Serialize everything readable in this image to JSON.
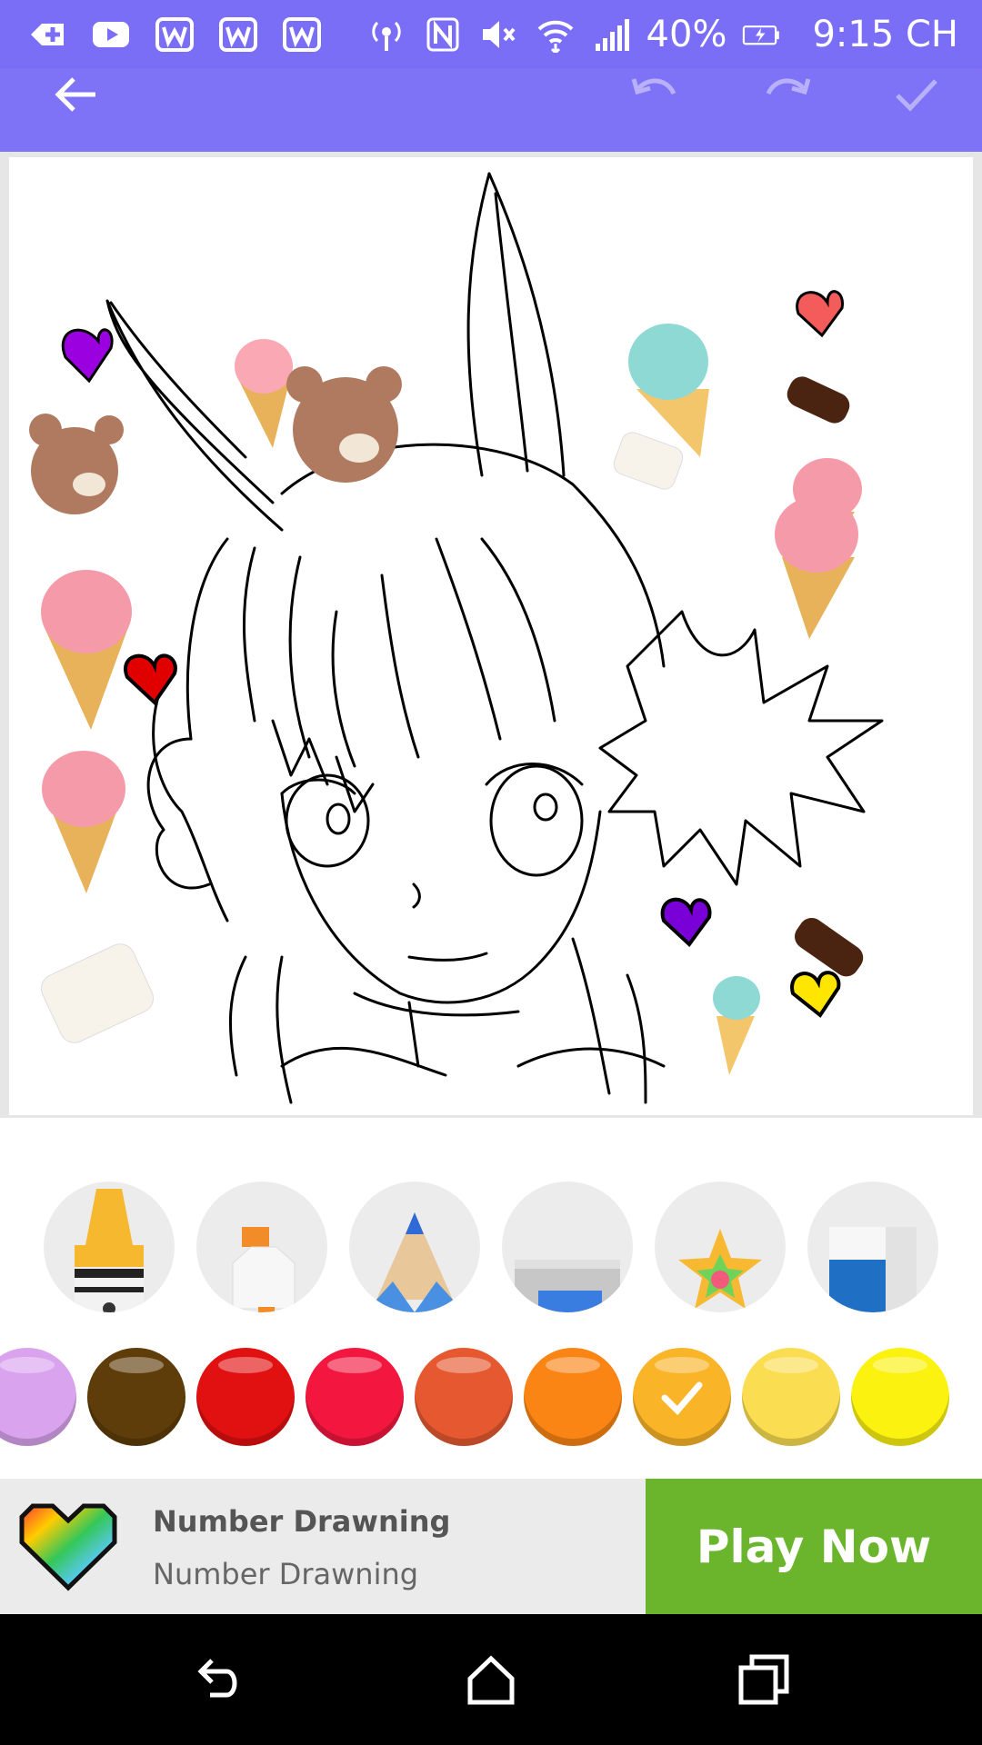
{
  "status_bar": {
    "icons_left": [
      "add-icon",
      "youtube-icon",
      "w-app-icon",
      "w-app-icon",
      "w-app-icon"
    ],
    "icons_right": [
      "hotspot-icon",
      "nfc-icon",
      "mute-icon",
      "wifi-icon",
      "signal-icon",
      "battery-charging-icon"
    ],
    "battery": "40%",
    "time": "9:15 CH"
  },
  "toolbar": {
    "back_icon": "arrow-left-icon",
    "undo_icon": "undo-icon",
    "redo_icon": "redo-icon",
    "done_icon": "check-icon",
    "color": "#7e72f6"
  },
  "tools": [
    {
      "name": "crayon",
      "icon": "crayon-icon"
    },
    {
      "name": "marker",
      "icon": "marker-icon"
    },
    {
      "name": "pencil",
      "icon": "pencil-icon"
    },
    {
      "name": "paint-bucket",
      "icon": "paint-bucket-icon"
    },
    {
      "name": "sticker",
      "icon": "star-sticker-icon"
    },
    {
      "name": "eraser",
      "icon": "eraser-icon"
    }
  ],
  "palette": {
    "colors": [
      "#d9a3ee",
      "#5e3d0a",
      "#e21111",
      "#f3173f",
      "#e55830",
      "#fb8514",
      "#f9b428",
      "#fbdd51",
      "#fbf210"
    ],
    "selected_index": 6
  },
  "ad": {
    "title": "Number Drawning",
    "subtitle": "Number Drawning",
    "cta": "Play Now",
    "cta_color": "#6bb52d"
  },
  "nav": {
    "back_icon": "back-icon",
    "home_icon": "home-icon",
    "recents_icon": "recents-icon"
  }
}
